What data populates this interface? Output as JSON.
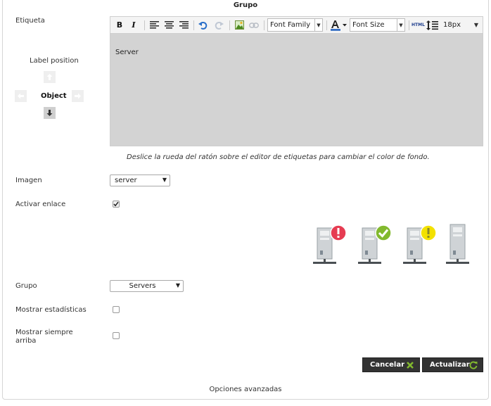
{
  "dialog": {
    "title": "Grupo"
  },
  "form": {
    "label_field": "Etiqueta",
    "label_position": {
      "title": "Label position",
      "center": "Object",
      "selected": "down"
    },
    "editor": {
      "toolbar": {
        "bold": "B",
        "italic": "I",
        "font_family": "Font Family",
        "font_size": "Font Size",
        "html": "HTML",
        "line_height": "18px"
      },
      "content": "Server",
      "hint": "Deslice la rueda del ratón sobre el editor de etiquetas para cambiar el color de fondo."
    },
    "image": {
      "label": "Imagen",
      "value": "server"
    },
    "enable_link": {
      "label": "Activar enlace",
      "checked": true
    },
    "group": {
      "label": "Grupo",
      "value": "Servers"
    },
    "show_stats": {
      "label": "Mostrar estadísticas",
      "checked": false
    },
    "always_on_top": {
      "label_line1": "Mostrar siempre",
      "label_line2": "arriba",
      "checked": false
    }
  },
  "preview_icons": [
    "server-critical-icon",
    "server-ok-icon",
    "server-warning-icon",
    "server-unknown-icon"
  ],
  "buttons": {
    "cancel": "Cancelar",
    "update": "Actualizar"
  },
  "advanced": "Opciones avanzadas",
  "colors": {
    "button_bg": "#333333",
    "accent_green": "#82b92e",
    "critical": "#e63c52",
    "warning": "#f3e100"
  }
}
